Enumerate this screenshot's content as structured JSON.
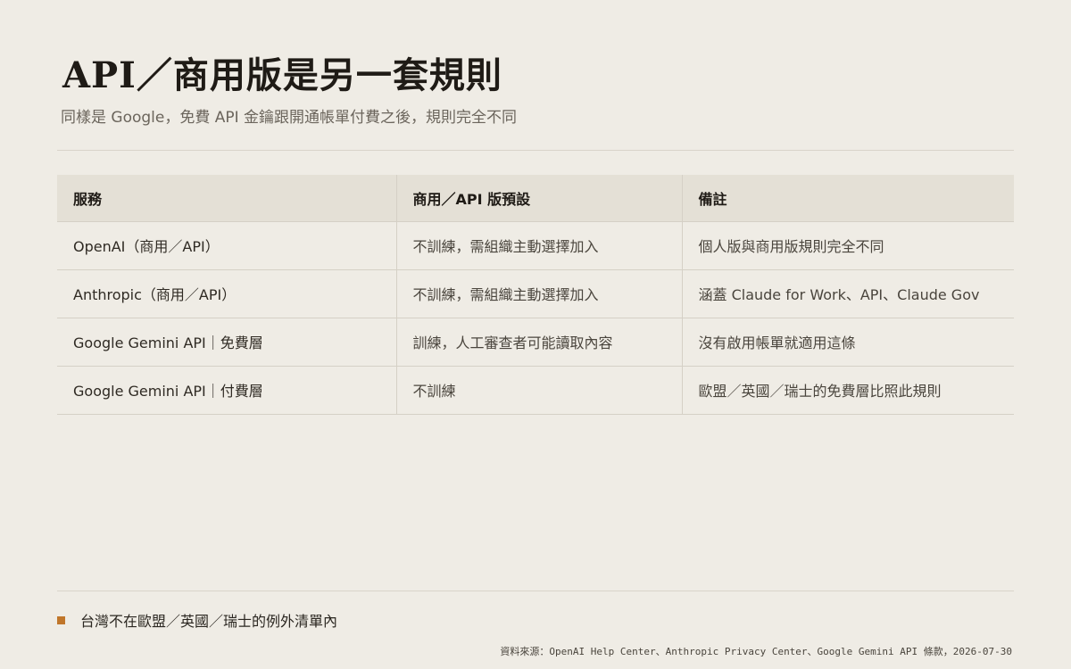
{
  "page": {
    "title": "API／商用版是另一套規則",
    "subtitle": "同樣是 Google，免費 API 金鑰跟開通帳單付費之後，規則完全不同"
  },
  "table": {
    "headers": [
      "服務",
      "商用／API 版預設",
      "備註"
    ],
    "rows": [
      {
        "service": "OpenAI（商用／API）",
        "default": "不訓練，需組織主動選擇加入",
        "note": "個人版與商用版規則完全不同"
      },
      {
        "service": "Anthropic（商用／API）",
        "default": "不訓練，需組織主動選擇加入",
        "note": "涵蓋 Claude for Work、API、Claude Gov"
      },
      {
        "service": "Google Gemini API｜免費層",
        "default": "訓練，人工審查者可能讀取內容",
        "note": "沒有啟用帳單就適用這條"
      },
      {
        "service": "Google Gemini API｜付費層",
        "default": "不訓練",
        "note": "歐盟／英國／瑞士的免費層比照此規則"
      }
    ]
  },
  "footnote": {
    "text": "台灣不在歐盟／英國／瑞士的例外清單內",
    "bullet_color": "#c0762a"
  },
  "source": "資料來源：OpenAI Help Center、Anthropic Privacy Center、Google Gemini API 條款，2026-07-30"
}
